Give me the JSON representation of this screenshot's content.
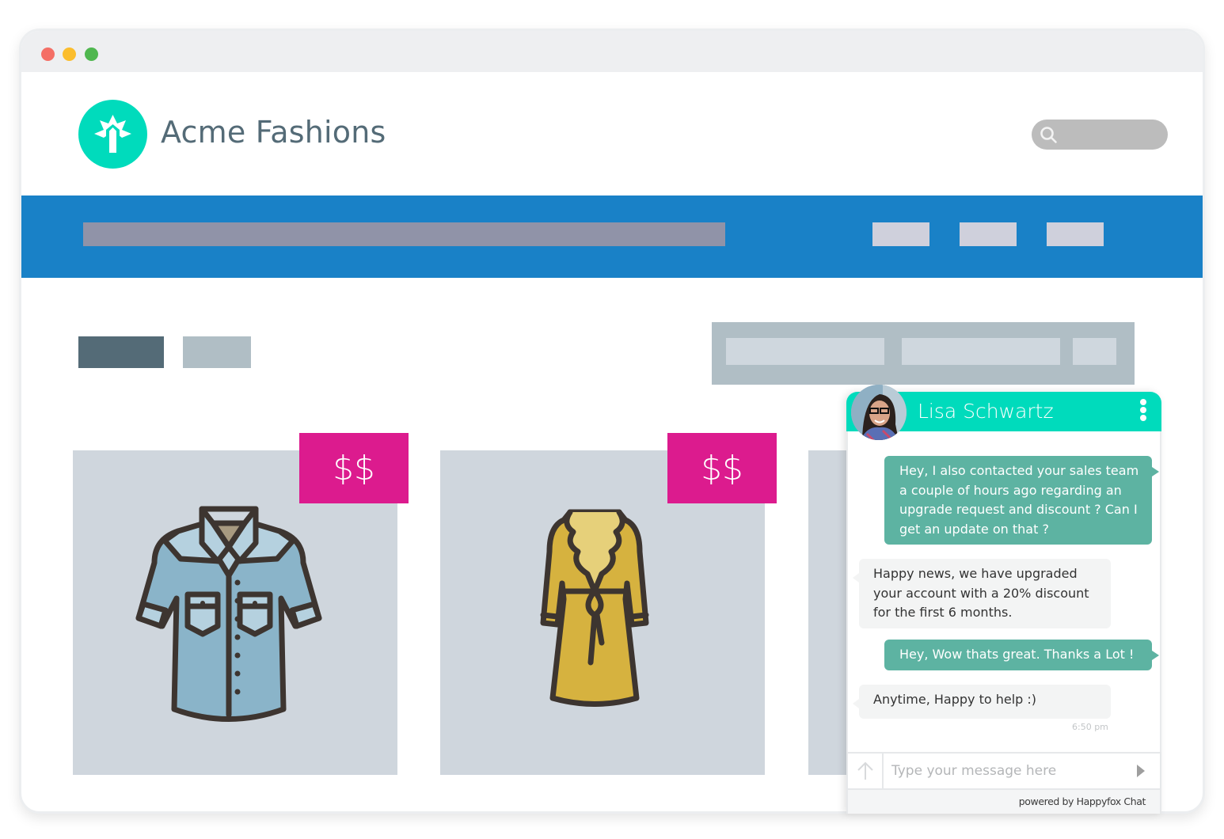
{
  "window": {
    "controls": [
      "close",
      "minimize",
      "maximize"
    ]
  },
  "header": {
    "brand_name": "Acme Fashions",
    "logo_icon": "brand-logo-icon",
    "search_icon": "search-icon",
    "search_placeholder": ""
  },
  "colors": {
    "brand_teal": "#00dbbc",
    "nav_blue": "#1981c7",
    "price_tag_magenta": "#dc1b8e",
    "chat_outgoing": "#5db3a2",
    "chat_incoming": "#f3f4f4",
    "brand_text": "#546b77"
  },
  "products": [
    {
      "price_label": "$$",
      "item": "denim-shirt"
    },
    {
      "price_label": "$$",
      "item": "yellow-dress"
    },
    {
      "price_label": "",
      "item": "partially-hidden"
    }
  ],
  "chat": {
    "agent_name": "Lisa Schwartz",
    "menu_icon": "kebab-menu-icon",
    "messages": [
      {
        "direction": "outgoing",
        "text": "Hey, I also contacted your sales team a couple of hours ago regarding an upgrade request and discount ? Can I get an update on that ?"
      },
      {
        "direction": "incoming",
        "text": "Happy news, we have upgraded your account with a 20% discount for the first 6 months."
      },
      {
        "direction": "outgoing",
        "text": "Hey, Wow thats great. Thanks a Lot !"
      },
      {
        "direction": "incoming",
        "text": "Anytime, Happy to help :)"
      }
    ],
    "timestamp": "6:50 pm",
    "input": {
      "value": "",
      "placeholder": "Type your message here"
    },
    "attach_icon": "arrow-up-icon",
    "send_icon": "send-triangle-icon",
    "footer": "powered by Happyfox Chat"
  }
}
